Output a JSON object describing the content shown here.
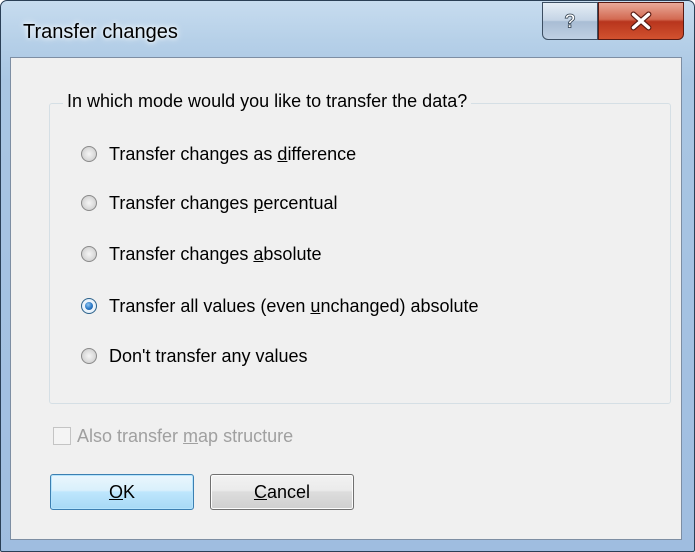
{
  "window": {
    "title": "Transfer changes",
    "help_glyph": "?",
    "help_icon": "question-icon",
    "close_icon": "close-x-icon"
  },
  "group": {
    "label": "In which mode would you like to transfer the data?"
  },
  "options": [
    {
      "pre": "Transfer changes as ",
      "key": "d",
      "post": "ifference",
      "checked": false
    },
    {
      "pre": "Transfer changes ",
      "key": "p",
      "post": "ercentual",
      "checked": false
    },
    {
      "pre": "Transfer changes ",
      "key": "a",
      "post": "bsolute",
      "checked": false
    },
    {
      "pre": "Transfer all values (even ",
      "key": "u",
      "post": "nchanged) absolute",
      "checked": true
    },
    {
      "pre": "Don't transfer any values",
      "key": "",
      "post": "",
      "checked": false
    }
  ],
  "checkbox": {
    "pre": "Also transfer ",
    "key": "m",
    "post": "ap structure",
    "checked": false,
    "enabled": false
  },
  "buttons": {
    "ok_pre": "",
    "ok_key": "O",
    "ok_post": "K",
    "cancel_pre": "",
    "cancel_key": "C",
    "cancel_post": "ancel"
  }
}
